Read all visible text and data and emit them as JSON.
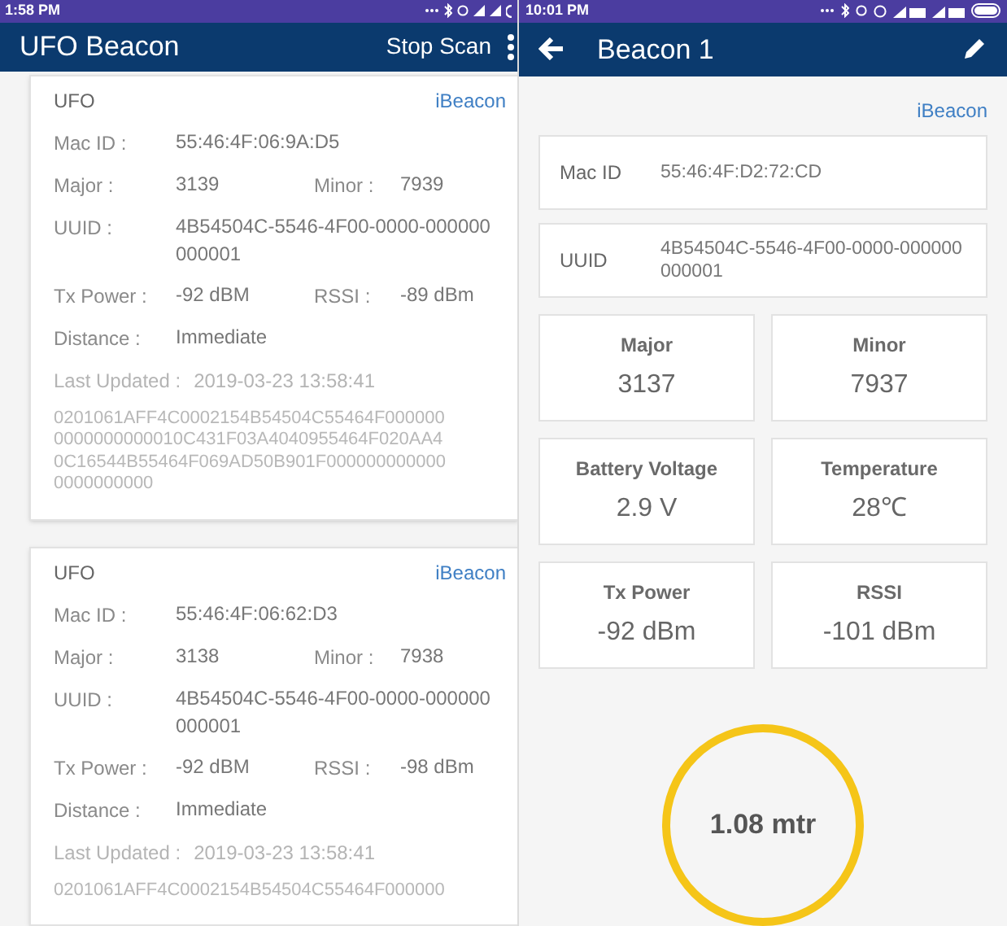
{
  "left_screen": {
    "status_bar": {
      "time": "1:58 PM"
    },
    "app_bar": {
      "title": "UFO Beacon",
      "action": "Stop Scan"
    },
    "beacons": [
      {
        "name": "UFO",
        "type": "iBeacon",
        "rows": [
          {
            "pairs": [
              {
                "label": "Mac ID :",
                "value": "55:46:4F:06:9A:D5"
              }
            ]
          },
          {
            "pairs": [
              {
                "label": "Major :",
                "value": "3139"
              },
              {
                "label": "Minor :",
                "value": "7939"
              }
            ]
          },
          {
            "pairs": [
              {
                "label": "UUID :",
                "value": "4B54504C-5546-4F00-0000-000000\n000001"
              }
            ]
          },
          {
            "pairs": [
              {
                "label": "Tx Power :",
                "value": "-92 dBM"
              },
              {
                "label": "RSSI :",
                "value": "-89 dBm"
              }
            ]
          },
          {
            "pairs": [
              {
                "label": "Distance :",
                "value": "Immediate"
              }
            ]
          }
        ],
        "last_updated": {
          "label": "Last Updated :",
          "value": "2019-03-23 13:58:41"
        },
        "raw_lines": [
          "0201061AFF4C0002154B54504C55464F000000",
          "0000000000010C431F03A4040955464F020AA4",
          "0C16544B55464F069AD50B901F000000000000",
          "0000000000"
        ]
      },
      {
        "name": "UFO",
        "type": "iBeacon",
        "rows": [
          {
            "pairs": [
              {
                "label": "Mac ID :",
                "value": "55:46:4F:06:62:D3"
              }
            ]
          },
          {
            "pairs": [
              {
                "label": "Major :",
                "value": "3138"
              },
              {
                "label": "Minor :",
                "value": "7938"
              }
            ]
          },
          {
            "pairs": [
              {
                "label": "UUID :",
                "value": "4B54504C-5546-4F00-0000-000000\n000001"
              }
            ]
          },
          {
            "pairs": [
              {
                "label": "Tx Power :",
                "value": "-92 dBM"
              },
              {
                "label": "RSSI :",
                "value": "-98 dBm"
              }
            ]
          },
          {
            "pairs": [
              {
                "label": "Distance :",
                "value": "Immediate"
              }
            ]
          }
        ],
        "last_updated": {
          "label": "Last Updated :",
          "value": "2019-03-23 13:58:41"
        },
        "raw_lines": [
          "0201061AFF4C0002154B54504C55464F000000"
        ]
      }
    ]
  },
  "right_screen": {
    "status_bar": {
      "time": "10:01 PM"
    },
    "app_bar": {
      "title": "Beacon 1"
    },
    "type": "iBeacon",
    "info_rows": [
      {
        "label": "Mac ID",
        "value": "55:46:4F:D2:72:CD"
      },
      {
        "label": "UUID",
        "value": "4B54504C-5546-4F00-0000-000000\n000001"
      }
    ],
    "tiles": [
      {
        "label": "Major",
        "value": "3137"
      },
      {
        "label": "Minor",
        "value": "7937"
      },
      {
        "label": "Battery Voltage",
        "value": "2.9 V"
      },
      {
        "label": "Temperature",
        "value": "28℃"
      },
      {
        "label": "Tx Power",
        "value": "-92 dBm"
      },
      {
        "label": "RSSI",
        "value": "-101 dBm"
      }
    ],
    "distance": "1.08 mtr"
  }
}
